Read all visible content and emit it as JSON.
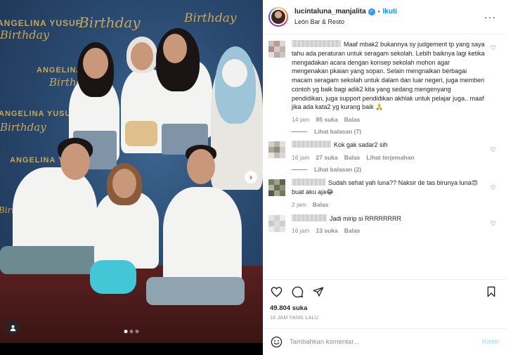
{
  "media": {
    "banner_name": "ANGELINA YUSUF",
    "banner_birthday": "Birthday",
    "next_arrow": "›",
    "carousel_total": 3,
    "carousel_active": 1
  },
  "header": {
    "username": "lucintaluna_manjalita",
    "separator": "•",
    "follow_label": "Ikuti",
    "location": "León Bar & Resto",
    "more": "···"
  },
  "comments": [
    {
      "text": "Maaf mbak2 bukannya sy judgement tp yang saya tahu ada peraturan untuk seragam sekolah. Lebih baiknya lagi ketika mengadakan acara dengan konsep sekolah mohon agar mengenakan pkaian yang sopan. Selain mengnalkan berbagai macam seragam sekolah untuk dalam dan luar negeri, juga memberi contoh yg baik bagi adik2 kita yang sedang mengenyang pendidikan, juga support pendidikan akhlak untuk pelajar juga.. maaf jika ada kata2 yg kurang baik 🙏",
      "time": "14 jam",
      "likes": "85 suka",
      "reply": "Balas",
      "translate": "",
      "view_replies": "Lihat balasan (7)"
    },
    {
      "text": "Kok gak sadar2 sih",
      "time": "16 jam",
      "likes": "27 suka",
      "reply": "Balas",
      "translate": "Lihat terjemahan",
      "view_replies": "Lihat balasan (2)"
    },
    {
      "text": "Sudah sehat yah luna?? Naksir de tas birunya luna😍 buat aku aja😂",
      "time": "2 jam",
      "likes": "",
      "reply": "Balas",
      "translate": "",
      "view_replies": ""
    },
    {
      "text": "Jadi mirip si RRRRRRRR",
      "time": "16 jam",
      "likes": "13 suka",
      "reply": "Balas",
      "translate": "",
      "view_replies": ""
    }
  ],
  "footer": {
    "likes": "49.804 suka",
    "timestamp": "16 JAM YANG LALU",
    "comment_placeholder": "Tambahkan komentar...",
    "post_label": "Kirim"
  },
  "colors": {
    "accent": "#0095f6",
    "verified": "#3897f0",
    "muted": "#8e8e8e",
    "post_disabled": "#b2dffc"
  }
}
